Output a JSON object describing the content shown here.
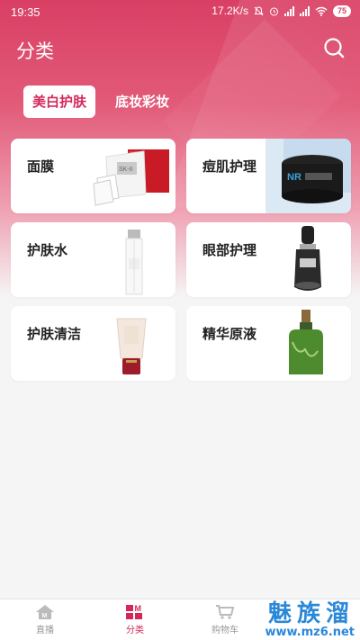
{
  "status_bar": {
    "time": "19:35",
    "network_speed": "17.2K/s",
    "battery": "75"
  },
  "header": {
    "title": "分类",
    "search_icon": "search-icon"
  },
  "tabs": [
    {
      "label": "美白护肤",
      "active": true
    },
    {
      "label": "底妆彩妆",
      "active": false
    }
  ],
  "categories": [
    {
      "label": "面膜",
      "image": "sheet-mask-box"
    },
    {
      "label": "痘肌护理",
      "image": "black-mask-jar"
    },
    {
      "label": "护肤水",
      "image": "toner-bottle"
    },
    {
      "label": "眼部护理",
      "image": "eye-serum-dropper"
    },
    {
      "label": "护肤清洁",
      "image": "cleanser-tube"
    },
    {
      "label": "精华原液",
      "image": "green-essence-bottle"
    }
  ],
  "bottom_nav": [
    {
      "label": "直播",
      "icon": "home-icon",
      "active": false
    },
    {
      "label": "分类",
      "icon": "category-icon",
      "active": true
    },
    {
      "label": "购物车",
      "icon": "cart-icon",
      "active": false
    }
  ],
  "watermark": {
    "cn": "魅族溜",
    "url": "www.mz6.net"
  },
  "colors": {
    "accent": "#d4285a",
    "hero_top": "#d93f64",
    "background": "#f5f5f5"
  }
}
